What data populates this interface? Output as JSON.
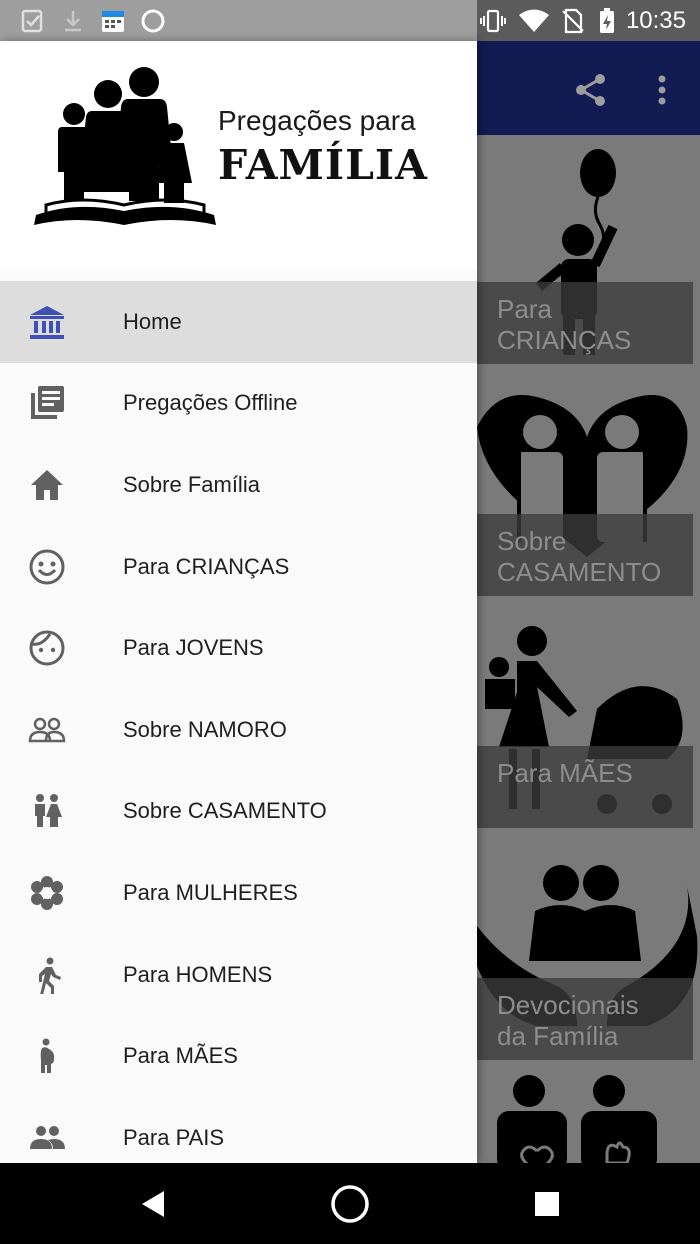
{
  "status_bar": {
    "time": "10:35",
    "left_icons": [
      "check-clipboard-icon",
      "download-icon",
      "calendar-icon",
      "circle-icon"
    ],
    "right_icons": [
      "vibrate-icon",
      "wifi-icon",
      "no-sim-icon",
      "battery-charging-icon"
    ]
  },
  "app_bar": {
    "actions": [
      "share-icon",
      "more-vert-icon"
    ],
    "color": "#121b52"
  },
  "drawer": {
    "brand_top": "Pregações para",
    "brand_main": "FAMÍLIA",
    "items": [
      {
        "label": "Home",
        "icon": "bank-icon",
        "active": true
      },
      {
        "label": "Pregações Offline",
        "icon": "library-books-icon"
      },
      {
        "label": "Sobre Família",
        "icon": "house-icon"
      },
      {
        "label": "Para CRIANÇAS",
        "icon": "smiley-face-icon"
      },
      {
        "label": "Para JOVENS",
        "icon": "face-icon"
      },
      {
        "label": "Sobre NAMORO",
        "icon": "couple-outline-icon"
      },
      {
        "label": "Sobre CASAMENTO",
        "icon": "wc-icon"
      },
      {
        "label": "Para MULHERES",
        "icon": "flower-icon"
      },
      {
        "label": "Para HOMENS",
        "icon": "walking-man-icon"
      },
      {
        "label": "Para MÃES",
        "icon": "pregnant-woman-icon"
      },
      {
        "label": "Para PAIS",
        "icon": "people-icon"
      }
    ],
    "accent": "#3f51b5"
  },
  "background_cards": [
    {
      "line1": "Para",
      "line2": "CRIANÇAS"
    },
    {
      "line1": "Sobre",
      "line2": "CASAMENTO"
    },
    {
      "line1": "Para MÃES",
      "line2": ""
    },
    {
      "line1": "Devocionais",
      "line2": "da Família"
    }
  ],
  "nav_bar": {
    "buttons": [
      "back-icon",
      "home-circle-icon",
      "recents-square-icon"
    ]
  }
}
